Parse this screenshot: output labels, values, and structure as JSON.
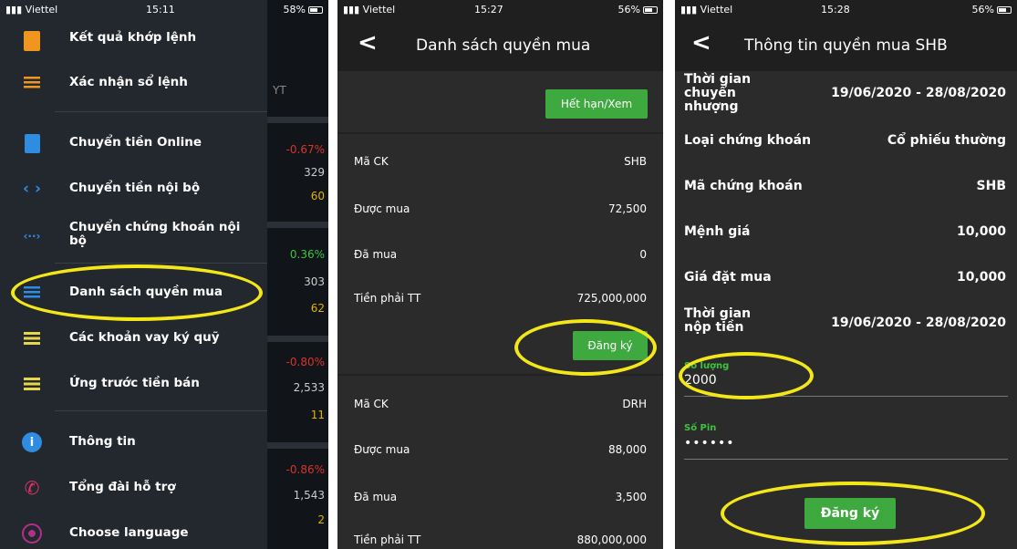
{
  "colors": {
    "accent_green": "#3ea93e",
    "highlight_oval": "#f3e71a",
    "negative": "#d9342b",
    "positive": "#3ec43e",
    "amber": "#e0b400"
  },
  "screen1": {
    "status": {
      "carrier": "Viettel",
      "time": "15:11",
      "battery": "58%"
    },
    "menu_items": [
      {
        "label": "Kết quả khớp lệnh",
        "icon": "document-icon"
      },
      {
        "label": "Xác nhận sổ lệnh",
        "icon": "list-icon"
      },
      {
        "label": "Chuyển tiền Online",
        "icon": "receipt-icon"
      },
      {
        "label": "Chuyển tiền nội bộ",
        "icon": "code-icon"
      },
      {
        "label": "Chuyển chứng khoán nội bộ",
        "icon": "transfer-icon"
      },
      {
        "label": "Danh sách quyền mua",
        "icon": "list-icon"
      },
      {
        "label": "Các khoản vay ký quỹ",
        "icon": "lines-icon"
      },
      {
        "label": "Ứng trước tiền bán",
        "icon": "lines-icon"
      },
      {
        "label": "Thông tin",
        "icon": "info-icon"
      },
      {
        "label": "Tổng đài hỗ trợ",
        "icon": "phone-icon"
      },
      {
        "label": "Choose language",
        "icon": "globe-icon"
      }
    ],
    "background_header": "YT",
    "background_values": [
      "-0.67%",
      "329",
      "60",
      "0.36%",
      "303",
      "62",
      "-0.80%",
      "2,533",
      "11",
      "-0.86%",
      "1,543",
      "2"
    ]
  },
  "screen2": {
    "status": {
      "carrier": "Viettel",
      "time": "15:27",
      "battery": "56%"
    },
    "title": "Danh sách quyền mua",
    "expired_button": "Hết hạn/Xem",
    "register_button": "Đăng ký",
    "items": [
      {
        "rows": [
          {
            "label": "Mã CK",
            "value": "SHB"
          },
          {
            "label": "Được mua",
            "value": "72,500"
          },
          {
            "label": "Đã mua",
            "value": "0"
          },
          {
            "label": "Tiền phải TT",
            "value": "725,000,000"
          }
        ]
      },
      {
        "rows": [
          {
            "label": "Mã CK",
            "value": "DRH"
          },
          {
            "label": "Được mua",
            "value": "88,000"
          },
          {
            "label": "Đã mua",
            "value": "3,500"
          },
          {
            "label": "Tiền phải TT",
            "value": "880,000,000"
          }
        ]
      }
    ]
  },
  "screen3": {
    "status": {
      "carrier": "Viettel",
      "time": "15:28",
      "battery": "56%"
    },
    "title": "Thông tin quyền mua SHB",
    "transfer_period": {
      "label": "Thời gian chuyển nhượng",
      "value": "19/06/2020 - 28/08/2020"
    },
    "rows": [
      {
        "label": "Loại chứng khoán",
        "value": "Cổ phiếu thường"
      },
      {
        "label": "Mã chứng khoán",
        "value": "SHB"
      },
      {
        "label": "Mệnh giá",
        "value": "10,000"
      },
      {
        "label": "Giá đặt mua",
        "value": "10,000"
      }
    ],
    "payment_period": {
      "label": "Thời gian nộp tiền",
      "value": "19/06/2020 - 28/08/2020"
    },
    "quantity": {
      "label": "Số lượng",
      "value": "2000"
    },
    "pin": {
      "label": "Số Pin",
      "value": "••••••"
    },
    "register_button": "Đăng ký"
  }
}
